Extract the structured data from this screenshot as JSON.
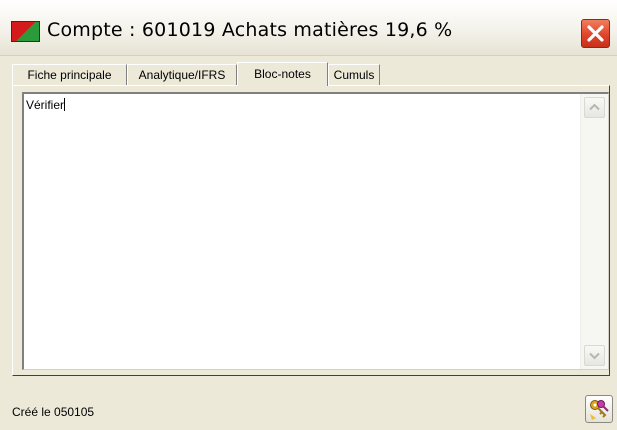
{
  "window": {
    "title": "Compte : 601019 Achats matières 19,6 %",
    "icon": "account-app-icon",
    "close_icon": "close-icon"
  },
  "tabs": [
    {
      "label": "Fiche principale",
      "active": false
    },
    {
      "label": "Analytique/IFRS",
      "active": false
    },
    {
      "label": "Bloc-notes",
      "active": true
    },
    {
      "label": "Cumuls",
      "active": false
    }
  ],
  "notes": {
    "text": "Vérifier"
  },
  "status": {
    "created_label": "Créé le 050105"
  },
  "actions": {
    "icon": "keys-icon"
  },
  "colors": {
    "window_bg": "#ece9d8",
    "close_button": "#e0442a",
    "text": "#000000"
  }
}
